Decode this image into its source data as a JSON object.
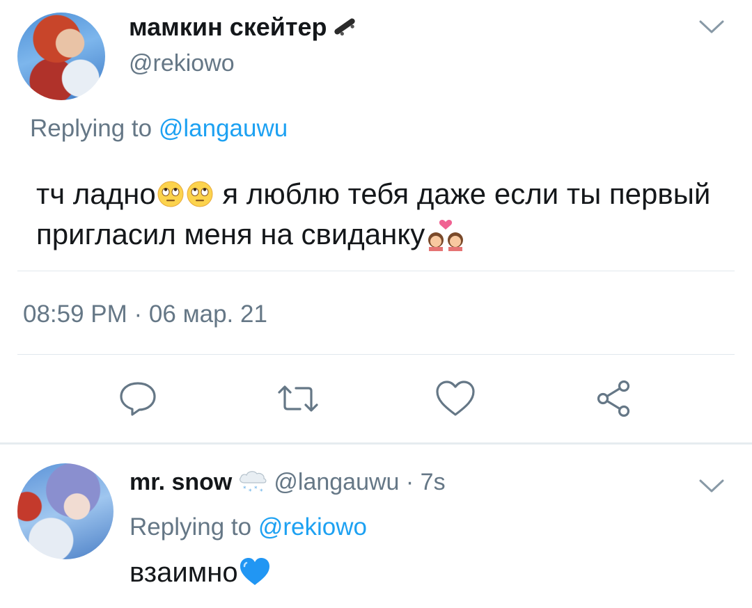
{
  "tweet": {
    "display_name": "мамкин скейтер",
    "name_emoji": "skateboard-icon",
    "handle": "@rekiowo",
    "replying_prefix": "Replying to",
    "replying_to": "@langauwu",
    "text_part1": "тч ладно",
    "text_part2": " я люблю тебя даже если ты первый пригласил меня на свиданку",
    "timestamp": "08:59 PM · 06 мар. 21",
    "actions": [
      "reply-icon",
      "retweet-icon",
      "like-icon",
      "share-icon"
    ]
  },
  "reply": {
    "display_name": "mr. snow",
    "name_emoji": "snow-cloud-icon",
    "handle_time": "@langauwu · 7s",
    "replying_prefix": "Replying to",
    "replying_to": "@rekiowo",
    "text": "взаимно",
    "text_emoji": "blue-heart-icon"
  },
  "colors": {
    "accent": "#1da1f2",
    "secondary_text": "#657786",
    "primary_text": "#14171a",
    "divider": "#e1e8ed"
  }
}
